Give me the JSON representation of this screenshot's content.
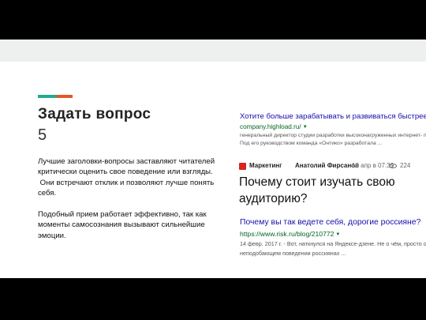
{
  "slide": {
    "title": "Задать вопрос",
    "number": "5",
    "body": {
      "paragraph_1_lines": [
        "Лучшие заголовки-вопросы заставляют читателей",
        "критически оценить свое поведение или взгляды.",
        " Они встречают отклик и позволяют лучше понять",
        "себя."
      ],
      "paragraph_2_lines": [
        "Подобный прием работает эффективно, так как",
        "моменты самосознания вызывают сильнейшие",
        "эмоции."
      ]
    }
  },
  "colors": {
    "accent_green": "#23a98e",
    "accent_orange": "#e5562a",
    "link_blue": "#1a0dab",
    "url_green": "#006621",
    "brand_red": "#d9231d"
  },
  "search_result_1": {
    "title": "Хотите больше зарабатывать и развиваться быстрее?",
    "url": "company.highload.ru/",
    "caret": "▼",
    "description_lines": [
      "генеральный директор студии разработки высоконагруженных интернет- про",
      "Под его руководством команда «Онтико» разработала ..."
    ]
  },
  "article": {
    "logo_icon": "square-logo-icon",
    "category": "Маркетинг",
    "author": "Анатолий Фирсанов",
    "date": "10 апр в 07:39",
    "views_icon": "eye-icon",
    "views": "224",
    "title_lines": [
      "Почему стоит изучать свою",
      "аудиторию?"
    ]
  },
  "search_result_2": {
    "title": "Почему вы так ведете себя, дорогие россияне?",
    "url": "https://www.risk.ru/blog/210772",
    "caret": "▼",
    "description_lines": [
      "14 февр. 2017 г. - Вот, наткнулся на Яндексе-дзене. Не о чём, просто об",
      "неподобающем поведении россиянах ..."
    ]
  }
}
